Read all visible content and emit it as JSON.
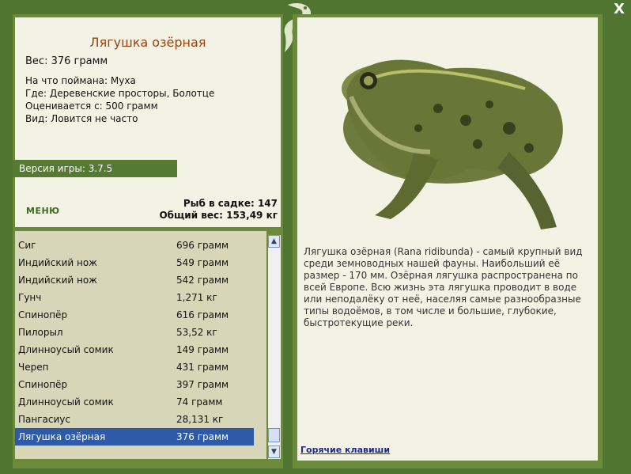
{
  "window": {
    "close_label": "X"
  },
  "fish": {
    "title": "Лягушка озёрная",
    "weight": "Вес: 376 грамм",
    "caught_with": "На что поймана: Муха",
    "location": "Где: Деревенские просторы, Болотце",
    "valued_from": "Оценивается с: 500 грамм",
    "rarity": "Вид: Ловится не часто"
  },
  "version": "Версия игры: 3.7.5",
  "menu_label": "МЕНЮ",
  "cage": {
    "fish_count": "Рыб в садке: 147",
    "total_weight": "Общий вес: 153,49 кг"
  },
  "catch_list": [
    {
      "name": "Сиг",
      "weight": "696 грамм"
    },
    {
      "name": "Индийский нож",
      "weight": "549 грамм"
    },
    {
      "name": "Индийский нож",
      "weight": "542 грамм"
    },
    {
      "name": "Гунч",
      "weight": "1,271 кг"
    },
    {
      "name": "Спинопёр",
      "weight": "616 грамм"
    },
    {
      "name": "Пилорыл",
      "weight": "53,52 кг"
    },
    {
      "name": "Длинноусый сомик",
      "weight": "149 грамм"
    },
    {
      "name": "Череп",
      "weight": "431 грамм"
    },
    {
      "name": "Спинопёр",
      "weight": "397 грамм"
    },
    {
      "name": "Длинноусый сомик",
      "weight": "74 грамм"
    },
    {
      "name": "Пангасиус",
      "weight": "28,131 кг"
    },
    {
      "name": "Лягушка озёрная",
      "weight": "376 грамм"
    }
  ],
  "selected_index": 11,
  "description": "Лягушка озёрная (Rana ridibunda) - самый крупный вид среди земноводных нашей фауны. Наибольший её размер - 170 мм. Озёрная лягушка распространена по всей Европе. Всю жизнь эта лягушка проводит в воде или неподалёку от неё, населяя самые разнообразные типы водоёмов, в том числе и большие, глубокие, быстротекущие реки.",
  "hotkeys_label": "Горячие клавиши",
  "colors": {
    "accent": "#a0410d",
    "frame": "#4f7530",
    "selected": "#2e5aa8"
  },
  "icons": {
    "logo": "lizard-logo-icon",
    "scroll_up": "arrow-up-icon",
    "scroll_down": "arrow-down-icon"
  }
}
